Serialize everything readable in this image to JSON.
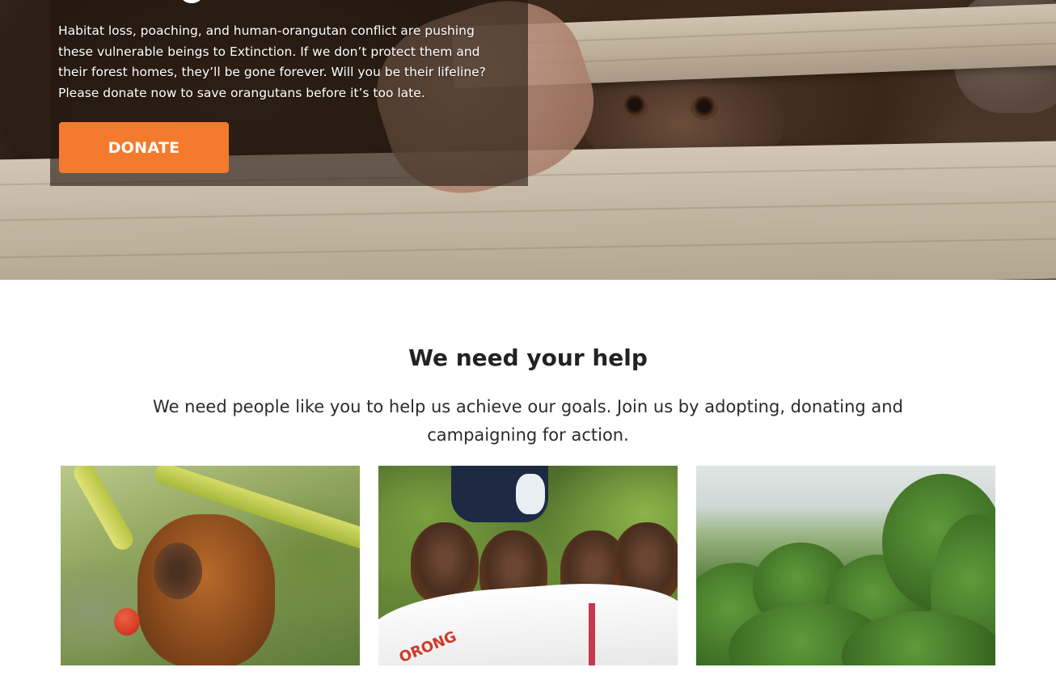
{
  "hero": {
    "body": "Habitat loss, poaching, and human-orangutan conflict are pushing these vulnerable beings to Extinction. If we don’t protect them and their forest homes, they’ll be gone forever. Will you be their lifeline? Please donate now to save orangutans before it’s too late.",
    "donate_label": "DONATE",
    "accent_color": "#f47a2d"
  },
  "help": {
    "title": "We need your help",
    "subtitle": "We need people like you to help us achieve our goals. Join us by adopting, donating and campaigning for action.",
    "cards": [
      {
        "image": "baby-orangutan-hanging-photo"
      },
      {
        "image": "orangutans-in-wheelbarrow-photo",
        "printed_text": "ORONG"
      },
      {
        "image": "rainforest-canopy-photo"
      }
    ]
  }
}
